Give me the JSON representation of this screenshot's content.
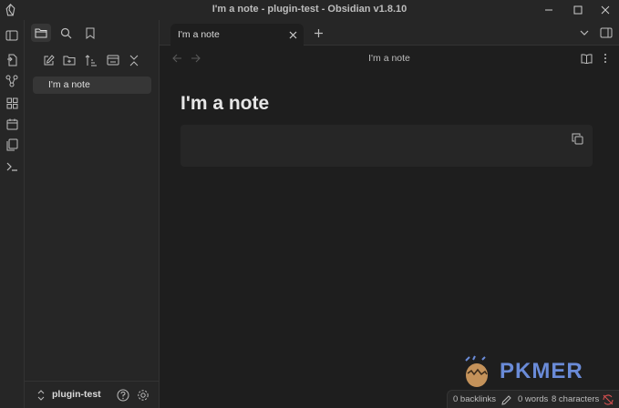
{
  "window": {
    "title": "I'm a note - plugin-test - Obsidian v1.8.10",
    "controls": [
      "minimize",
      "maximize",
      "close"
    ]
  },
  "ribbon": {
    "items": [
      "open-quick-switcher-icon",
      "graph-view-icon",
      "canvas-icon",
      "daily-note-icon",
      "templates-icon",
      "command-palette-icon"
    ]
  },
  "sidebar": {
    "tabs": [
      "files-icon",
      "search-icon",
      "bookmarks-icon"
    ],
    "actions": [
      "new-note-icon",
      "new-folder-icon",
      "sort-icon",
      "auto-reveal-icon",
      "collapse-all-icon"
    ],
    "files": [
      {
        "label": "I'm a note"
      }
    ],
    "vault": {
      "name": "plugin-test"
    }
  },
  "tabs": [
    {
      "label": "I'm a note"
    }
  ],
  "view": {
    "title": "I'm a note"
  },
  "note": {
    "title": "I'm a note"
  },
  "watermark": {
    "text": "PKMER"
  },
  "status": {
    "backlinks": "0 backlinks",
    "words": "0 words",
    "characters": "8 characters"
  },
  "colors": {
    "accent": "#6a8bd8",
    "background": "#1e1e1e",
    "panel": "#262626"
  }
}
